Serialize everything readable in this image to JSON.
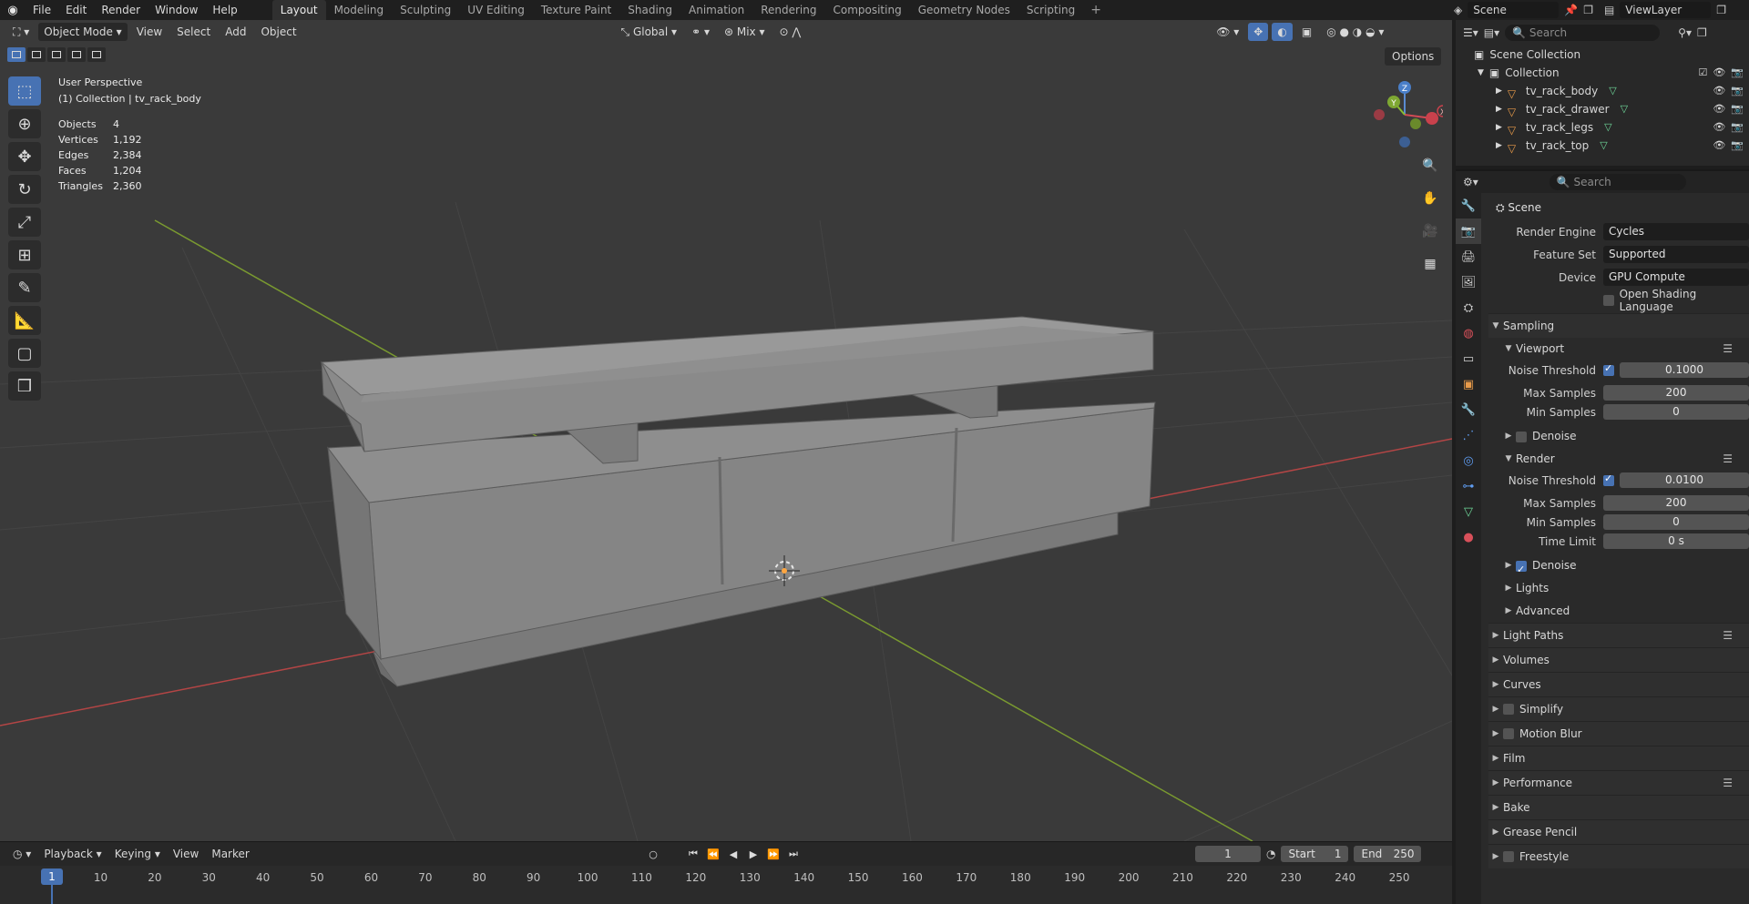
{
  "menubar": {
    "items": [
      "File",
      "Edit",
      "Render",
      "Window",
      "Help"
    ],
    "workspaces": [
      "Layout",
      "Modeling",
      "Sculpting",
      "UV Editing",
      "Texture Paint",
      "Shading",
      "Animation",
      "Rendering",
      "Compositing",
      "Geometry Nodes",
      "Scripting"
    ],
    "add_tab": "+",
    "scene": "Scene",
    "view_layer": "ViewLayer"
  },
  "viewport": {
    "mode": "Object Mode",
    "menus": [
      "View",
      "Select",
      "Add",
      "Object"
    ],
    "transform_orientation": "Global",
    "snap": "Mix",
    "options_label": "Options",
    "perspective": "User Perspective",
    "collection_info": "(1) Collection | tv_rack_body",
    "stats": [
      {
        "label": "Objects",
        "value": "4"
      },
      {
        "label": "Vertices",
        "value": "1,192"
      },
      {
        "label": "Edges",
        "value": "2,384"
      },
      {
        "label": "Faces",
        "value": "1,204"
      },
      {
        "label": "Triangles",
        "value": "2,360"
      }
    ],
    "gizmo": {
      "x": "X",
      "y": "Y",
      "z": "Z"
    }
  },
  "timeline": {
    "menus": [
      "Playback",
      "Keying",
      "View",
      "Marker"
    ],
    "current_frame": "1",
    "start_label": "Start",
    "start": "1",
    "end_label": "End",
    "end": "250",
    "ticks": [
      "10",
      "20",
      "30",
      "40",
      "50",
      "60",
      "70",
      "80",
      "90",
      "100",
      "110",
      "120",
      "130",
      "140",
      "150",
      "160",
      "170",
      "180",
      "190",
      "200",
      "210",
      "220",
      "230",
      "240",
      "250"
    ]
  },
  "outliner": {
    "search_placeholder": "Search",
    "scene_collection": "Scene Collection",
    "collection": "Collection",
    "objects": [
      "tv_rack_body",
      "tv_rack_drawer",
      "tv_rack_legs",
      "tv_rack_top"
    ]
  },
  "properties": {
    "search_placeholder": "Search",
    "scene_label": "Scene",
    "render_engine_label": "Render Engine",
    "render_engine": "Cycles",
    "feature_set_label": "Feature Set",
    "feature_set": "Supported",
    "device_label": "Device",
    "device": "GPU Compute",
    "osl_label": "Open Shading Language",
    "sampling": "Sampling",
    "viewport": "Viewport",
    "noise_threshold_label": "Noise Threshold",
    "viewport_noise": "0.1000",
    "max_samples_label": "Max Samples",
    "viewport_max": "200",
    "min_samples_label": "Min Samples",
    "viewport_min": "0",
    "denoise": "Denoise",
    "render": "Render",
    "render_noise": "0.0100",
    "render_max": "200",
    "render_min": "0",
    "time_limit_label": "Time Limit",
    "time_limit": "0 s",
    "lights": "Lights",
    "advanced": "Advanced",
    "panels": [
      "Light Paths",
      "Volumes",
      "Curves",
      "Simplify",
      "Motion Blur",
      "Film",
      "Performance",
      "Bake",
      "Grease Pencil",
      "Freestyle"
    ]
  }
}
